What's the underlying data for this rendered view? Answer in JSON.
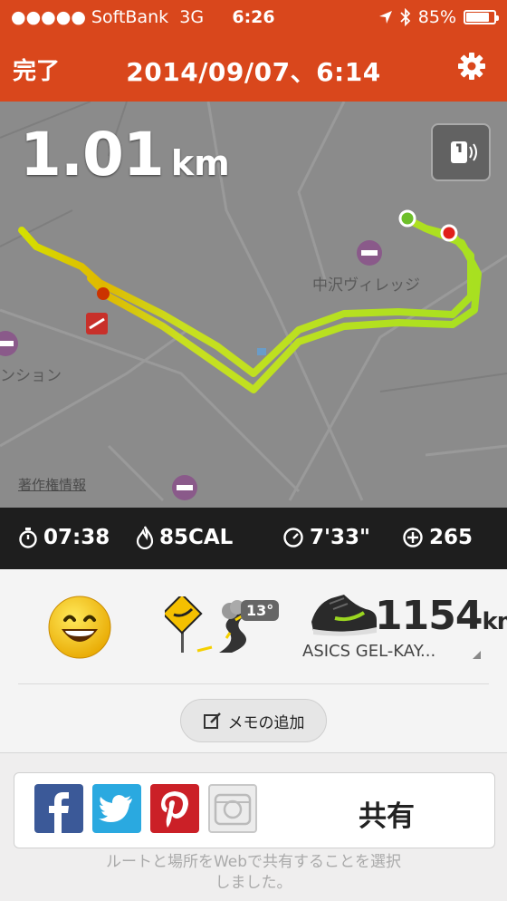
{
  "status_bar": {
    "carrier": "●●●●● SoftBank",
    "network": "3G",
    "time": "6:26",
    "battery": "85%",
    "battery_level": 0.85
  },
  "nav": {
    "done_label": "完了",
    "title": "2014/09/07、6:14"
  },
  "map": {
    "distance_value": "1.01",
    "distance_unit": "km",
    "place_label": "中沢ヴィレッジ",
    "side_label": "ンション",
    "copyright": "著作権情報"
  },
  "stats": {
    "duration": "07:38",
    "calories": "85CAL",
    "pace": "7'33\"",
    "fuel": "265"
  },
  "summary": {
    "temperature": "13°",
    "shoe_distance": "1154",
    "shoe_unit": "km",
    "shoe_name": "ASICS GEL-KAY...",
    "memo_label": "メモの追加"
  },
  "share": {
    "label": "共有",
    "note_line1": "ルートと場所をWebで共有することを選択",
    "note_line2": "しました。"
  },
  "colors": {
    "brand": "#d9471c",
    "stats_bg": "#1e1e1e",
    "facebook": "#3b5998",
    "twitter": "#2aa9e0",
    "pinterest": "#cb2027"
  }
}
